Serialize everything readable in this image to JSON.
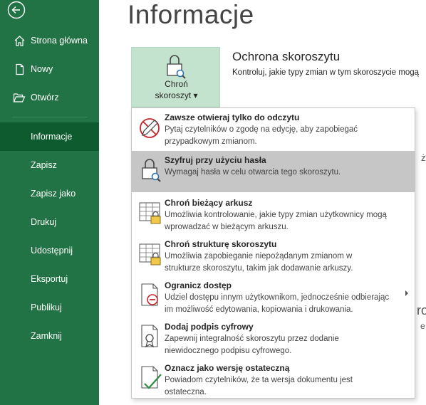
{
  "sidebar": {
    "items": [
      {
        "label": "Strona główna",
        "icon": "home-icon"
      },
      {
        "label": "Nowy",
        "icon": "new-document-icon"
      },
      {
        "label": "Otwórz",
        "icon": "folder-open-icon"
      },
      {
        "label": "Informacje",
        "active": true
      },
      {
        "label": "Zapisz"
      },
      {
        "label": "Zapisz jako"
      },
      {
        "label": "Drukuj"
      },
      {
        "label": "Udostępnij"
      },
      {
        "label": "Eksportuj"
      },
      {
        "label": "Publikuj"
      },
      {
        "label": "Zamknij"
      }
    ],
    "color": "#217346",
    "active_color": "#0f5b30"
  },
  "main": {
    "title": "Informacje",
    "protect_button": {
      "line1": "Chroń",
      "line2": "skoroszyt ▾"
    },
    "section_title": "Ochrona skoroszytu",
    "section_desc": "Kontroluj, jakie typy zmian w tym skoroszycie mogą",
    "fragments": [
      "ż",
      "ro",
      "e"
    ]
  },
  "menu": {
    "items": [
      {
        "title": "Zawsze otwieraj tylko do odczytu",
        "line1": "Pytaj czytelników o zgodę na edycję, aby zapobiegać",
        "line2": "przypadkowym zmianom.",
        "icon": "pencil-prohibited-icon"
      },
      {
        "title": "Szyfruj przy użyciu hasła",
        "line1": "Wymagaj hasła w celu otwarcia tego skoroszytu.",
        "line2": "",
        "icon": "lock-magnifier-icon",
        "highlighted": true
      },
      {
        "title": "Chroń bieżący arkusz",
        "line1": "Umożliwia kontrolowanie, jakie typy zmian użytkownicy mogą",
        "line2": "wprowadzać w bieżącym arkuszu.",
        "icon": "sheet-lock-icon"
      },
      {
        "title": "Chroń strukturę skoroszytu",
        "line1": "Umożliwia zapobieganie niepożądanym zmianom w",
        "line2": "strukturze skoroszytu, takim jak dodawanie arkuszy.",
        "icon": "workbook-structure-lock-icon"
      },
      {
        "title": "Ogranicz dostęp",
        "line1": "Udziel dostępu innym użytkownikom, jednocześnie odbierając",
        "line2": "im możliwość edytowania, kopiowania i drukowania.",
        "icon": "restricted-access-icon",
        "has_submenu": true
      },
      {
        "title": "Dodaj podpis cyfrowy",
        "line1": "Zapewnij integralność skoroszytu przez dodanie",
        "line2": "niewidocznego podpisu cyfrowego.",
        "icon": "digital-signature-icon"
      },
      {
        "title": "Oznacz jako wersję ostateczną",
        "line1": "Powiadom czytelników, że ta wersja dokumentu jest",
        "line2": "ostateczna.",
        "icon": "mark-final-icon"
      }
    ],
    "highlight_color": "#c6c6c6"
  }
}
